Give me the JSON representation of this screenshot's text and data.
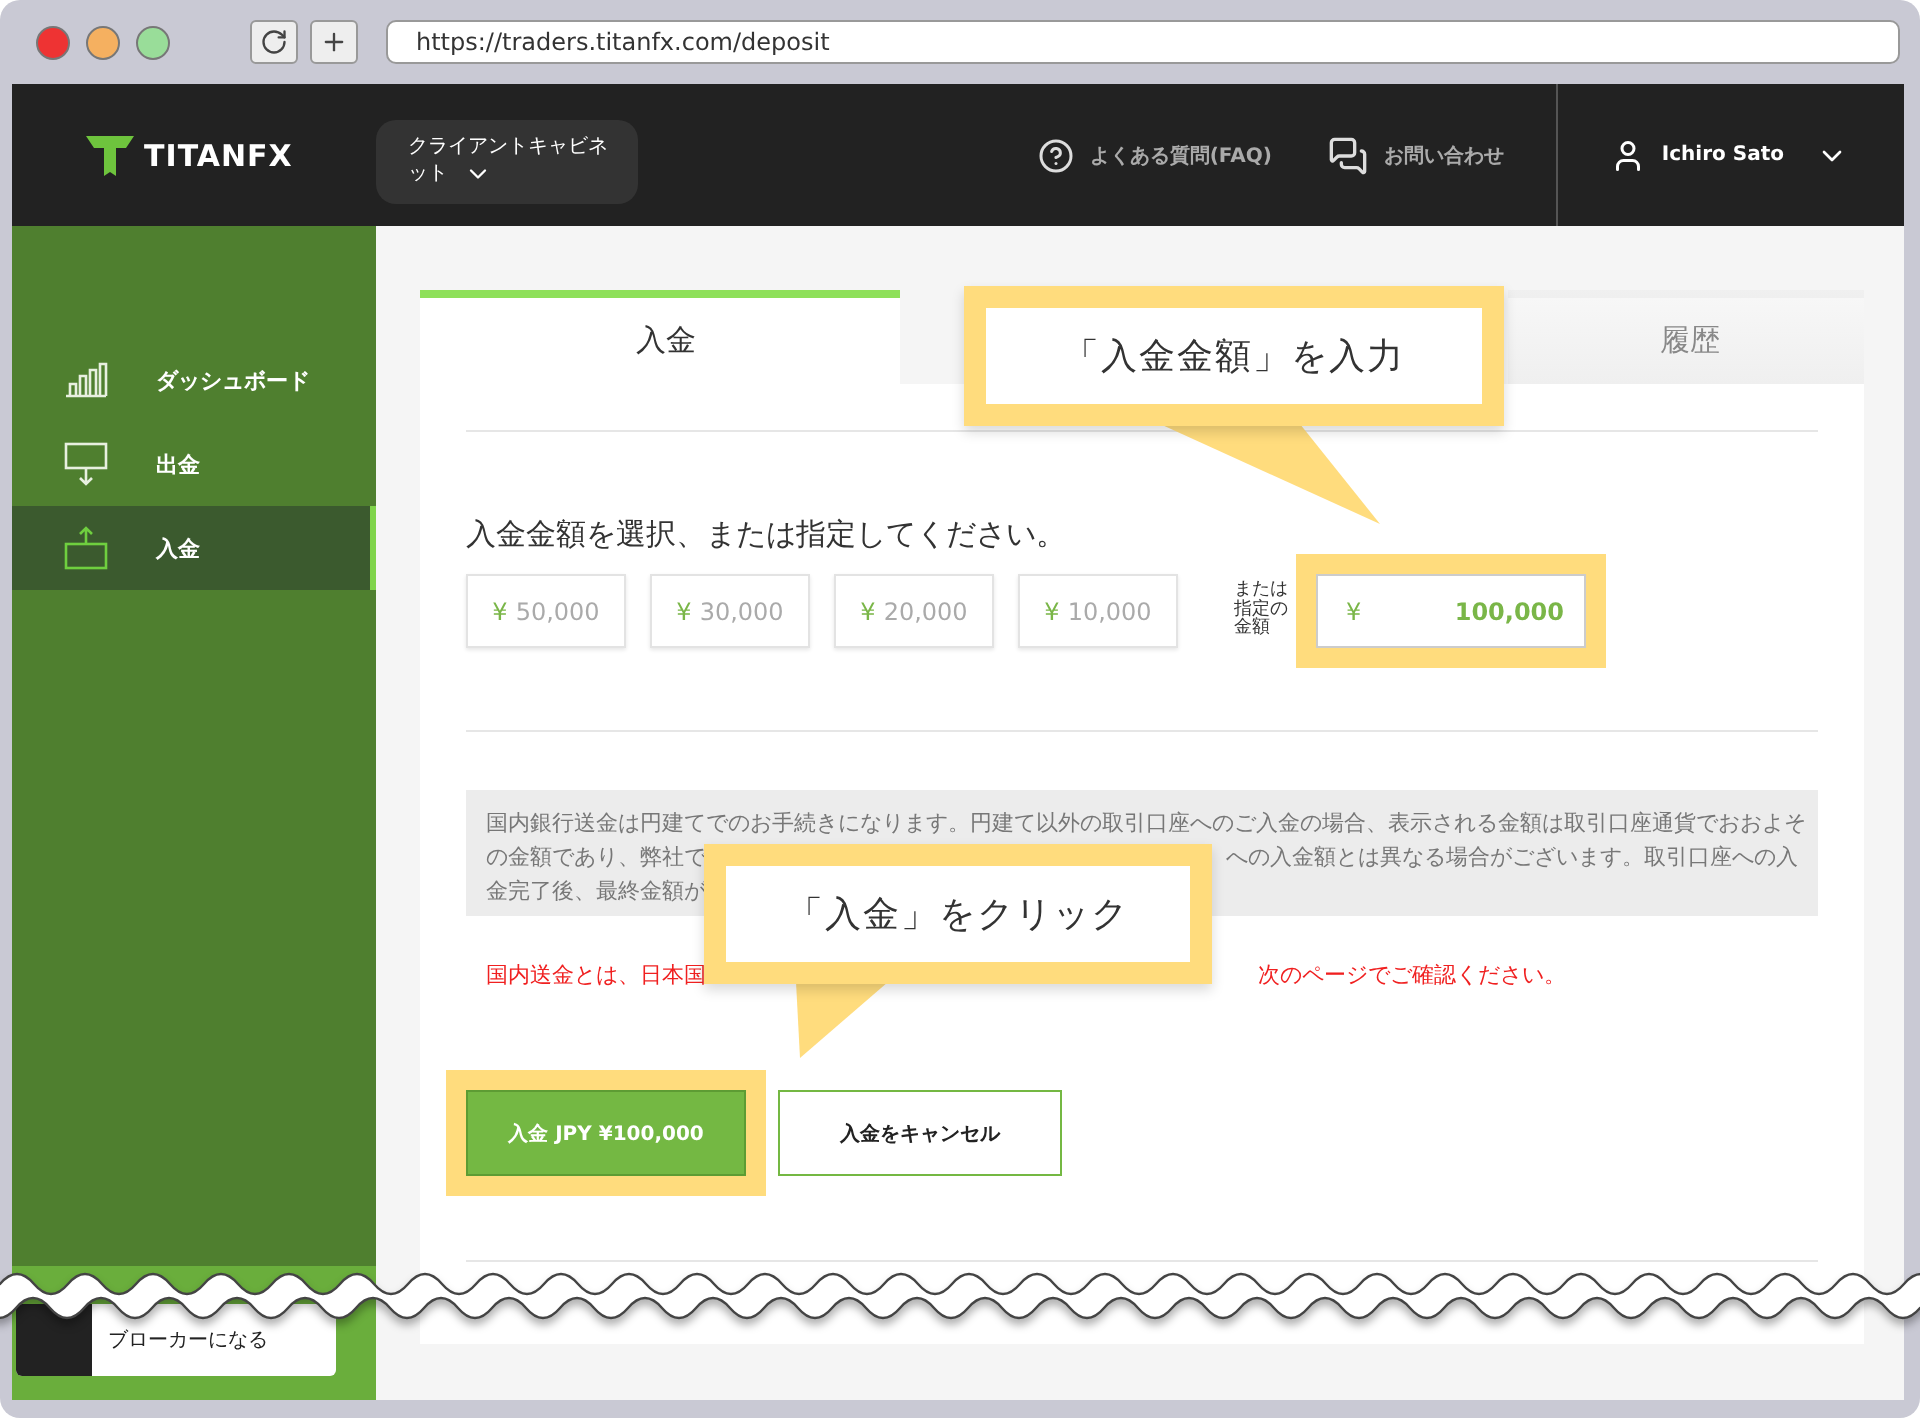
{
  "browser": {
    "url": "https://traders.titanfx.com/deposit"
  },
  "header": {
    "logo": "TITANFX",
    "cabinet_menu": "クライアントキャビネット",
    "faq": "よくある質問(FAQ)",
    "contact": "お問い合わせ",
    "user": "Ichiro Sato"
  },
  "sidebar": {
    "items": [
      {
        "label": "ダッシュボード",
        "kind": "chart",
        "selected": false
      },
      {
        "label": "出金",
        "kind": "withdraw",
        "selected": false
      },
      {
        "label": "入金",
        "kind": "deposit",
        "selected": true
      }
    ],
    "promo": "ブローカーになる"
  },
  "tabs": [
    {
      "label": "入金",
      "selected": true
    },
    {
      "label": "履歴",
      "selected": false
    }
  ],
  "deposit": {
    "prompt": "入金金額を選択、または指定してください。",
    "presets": [
      {
        "currency": "¥",
        "amount": "50,000"
      },
      {
        "currency": "¥",
        "amount": "30,000"
      },
      {
        "currency": "¥",
        "amount": "20,000"
      },
      {
        "currency": "¥",
        "amount": "10,000"
      }
    ],
    "custom_label": "または指定の金額",
    "custom_currency": "¥",
    "custom_value": "100,000",
    "notice_lines": [
      [
        "国内銀行送金は円建てでのお手続きになります。円建て以外の取引口座へのご入金の場合、表示される金額は取引口座通貨でおおよそ"
      ],
      [
        "の金額であり、弊社で",
        "への入金額とは異なる場合がございます。取引口座への入"
      ],
      [
        "金完了後、最終金額が"
      ]
    ],
    "warning": [
      "国内送金とは、日本国",
      "次のページでご確認ください。"
    ],
    "submit": "入金 JPY ¥100,000",
    "cancel": "入金をキャンセル"
  },
  "callouts": [
    {
      "text": "「入金金額」を入力"
    },
    {
      "text": "「入金」をクリック"
    }
  ]
}
